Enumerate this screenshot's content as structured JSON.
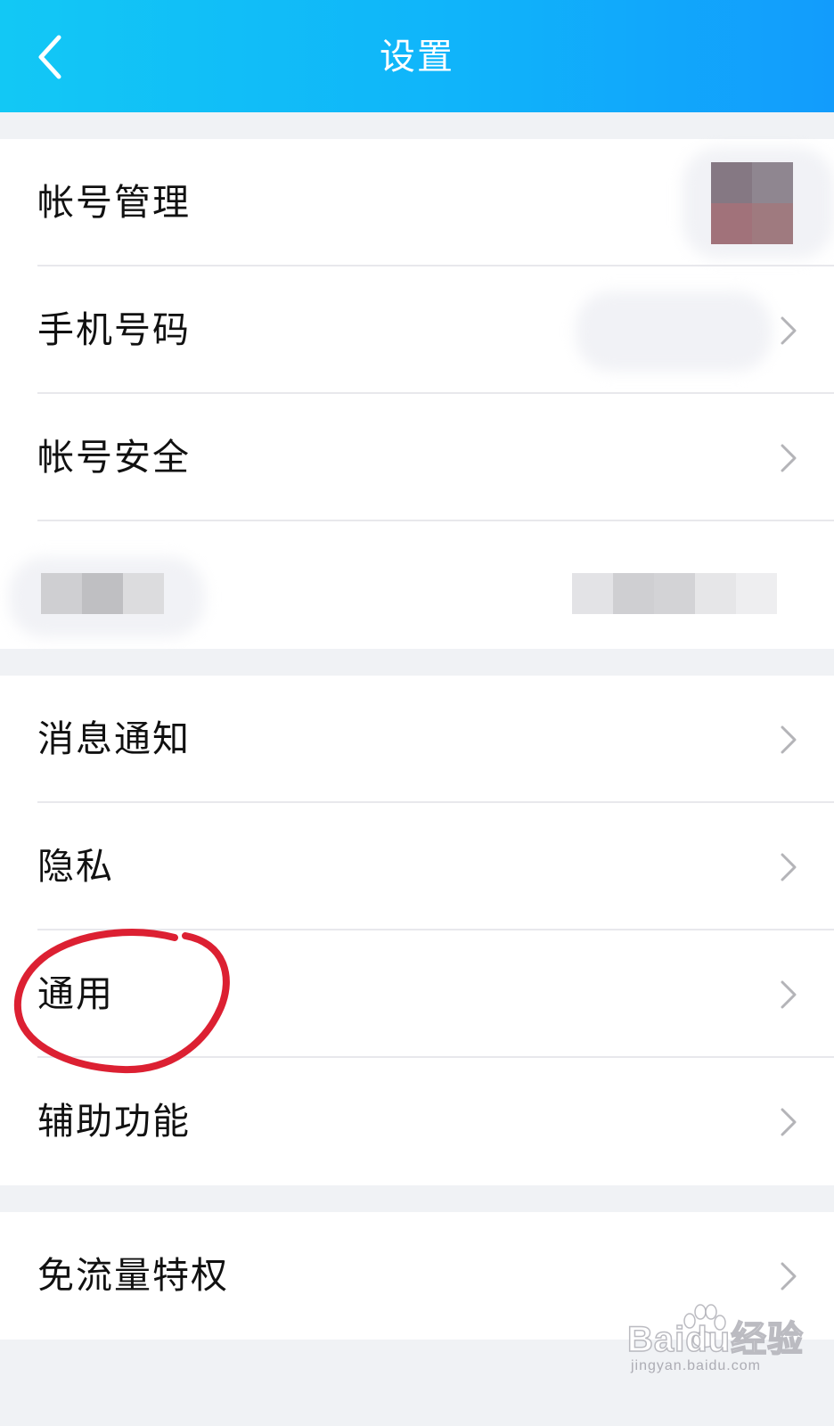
{
  "header": {
    "title": "设置",
    "background_colors": [
      "#12c8f5",
      "#129cfc"
    ]
  },
  "groups": [
    {
      "items": [
        {
          "label": "帐号管理",
          "trailing": "avatar"
        },
        {
          "label": "手机号码",
          "trailing": "chevron-right-icon"
        },
        {
          "label": "帐号安全",
          "trailing": "chevron-right-icon"
        },
        {
          "label": "",
          "trailing": "redacted"
        }
      ]
    },
    {
      "items": [
        {
          "label": "消息通知",
          "trailing": "chevron-right-icon"
        },
        {
          "label": "隐私",
          "trailing": "chevron-right-icon"
        },
        {
          "label": "通用",
          "trailing": "chevron-right-icon",
          "annotation": "red-hand-drawn-circle"
        },
        {
          "label": "辅助功能",
          "trailing": "chevron-right-icon"
        }
      ]
    },
    {
      "items": [
        {
          "label": "免流量特权",
          "trailing": "chevron-right-icon"
        }
      ]
    }
  ],
  "colors": {
    "page_background": "#f0f2f5",
    "row_background": "#ffffff",
    "divider": "#e8e8ec",
    "label_text": "#111111",
    "chevron": "#b4b4b8",
    "annotation_circle": "#dc2032"
  },
  "watermark": {
    "brand": "Baidu经验",
    "url": "jingyan.baidu.com"
  }
}
